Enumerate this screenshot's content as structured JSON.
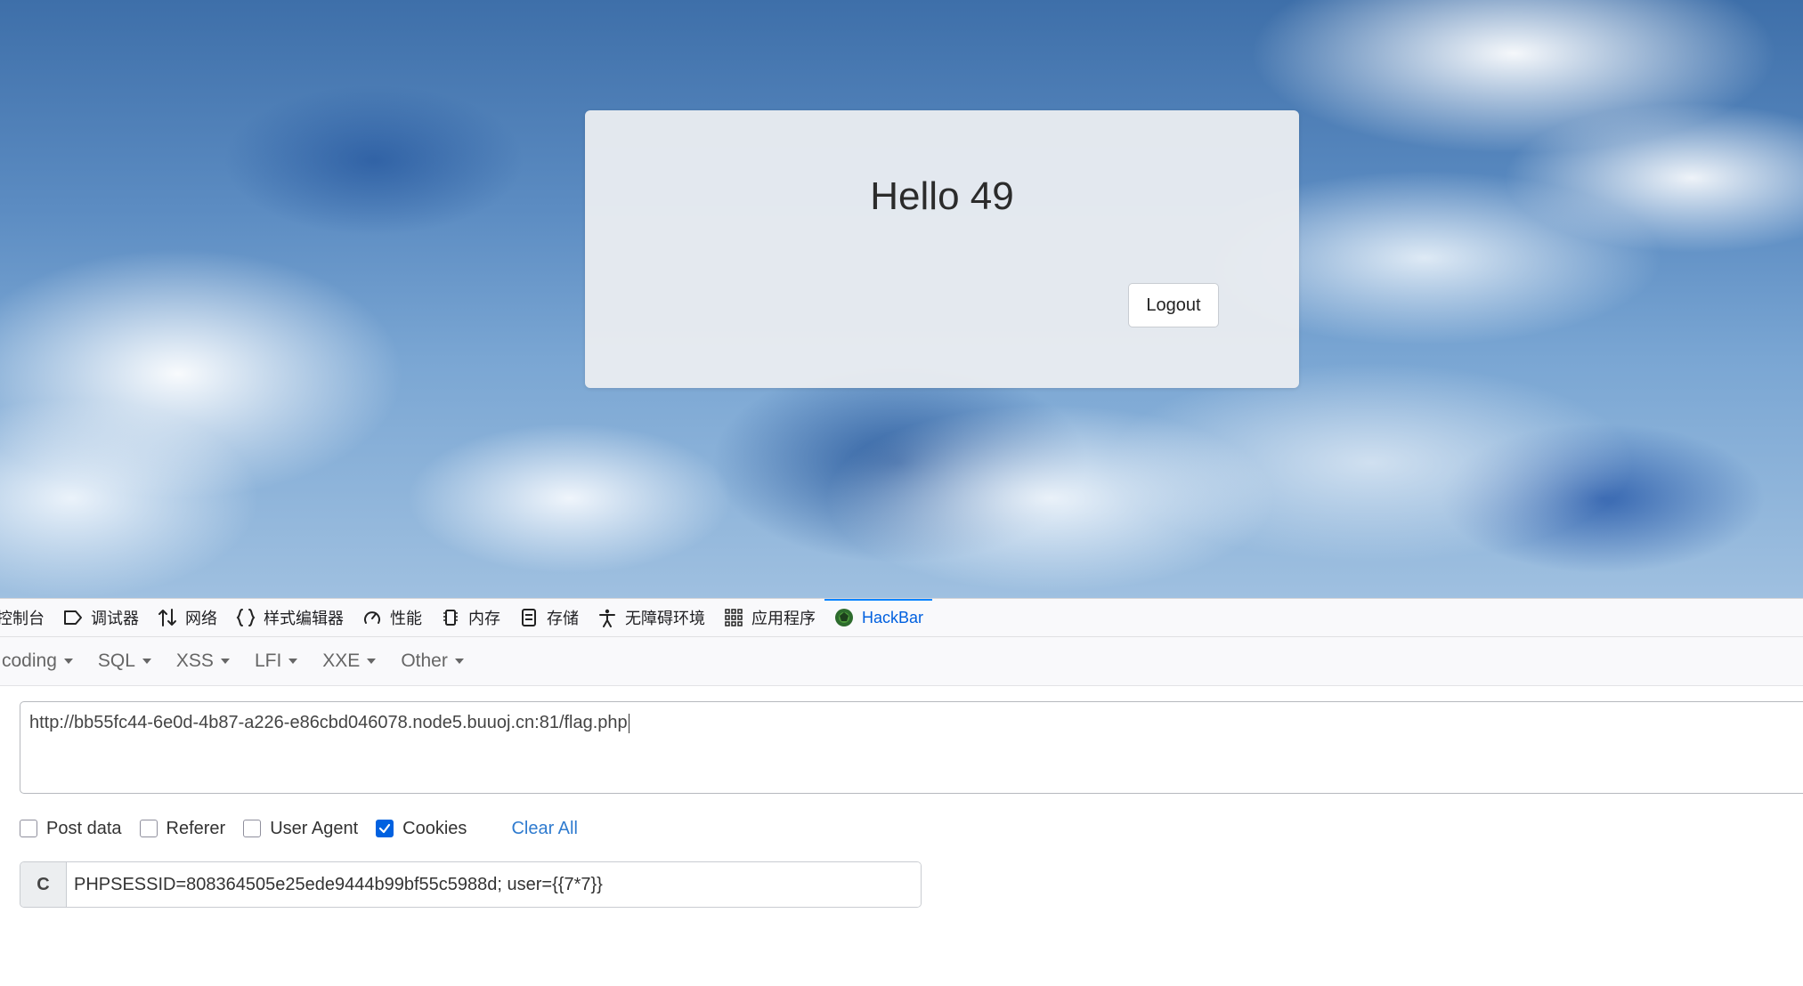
{
  "page": {
    "greeting": "Hello 49",
    "logout_label": "Logout"
  },
  "devtools": {
    "tabs": [
      {
        "label": "控制台",
        "icon": "console-icon"
      },
      {
        "label": "调试器",
        "icon": "debugger-icon"
      },
      {
        "label": "网络",
        "icon": "network-icon"
      },
      {
        "label": "样式编辑器",
        "icon": "style-editor-icon"
      },
      {
        "label": "性能",
        "icon": "performance-icon"
      },
      {
        "label": "内存",
        "icon": "memory-icon"
      },
      {
        "label": "存储",
        "icon": "storage-icon"
      },
      {
        "label": "无障碍环境",
        "icon": "accessibility-icon"
      },
      {
        "label": "应用程序",
        "icon": "application-icon"
      },
      {
        "label": "HackBar",
        "icon": "hackbar-icon",
        "active": true
      }
    ],
    "active_color": "#0060df"
  },
  "hackbar": {
    "menu": [
      "coding",
      "SQL",
      "XSS",
      "LFI",
      "XXE",
      "Other"
    ],
    "url": "http://bb55fc44-6e0d-4b87-a226-e86cbd046078.node5.buuoj.cn:81/flag.php",
    "options": [
      {
        "label": "Post data",
        "checked": false
      },
      {
        "label": "Referer",
        "checked": false
      },
      {
        "label": "User Agent",
        "checked": false
      },
      {
        "label": "Cookies",
        "checked": true
      }
    ],
    "clear_all_label": "Clear All",
    "cookie_prefix": "C",
    "cookie_value": "PHPSESSID=808364505e25ede9444b99bf55c5988d; user={{7*7}}",
    "link_color": "#2f7bcf",
    "checkbox_color": "#0061e0"
  }
}
